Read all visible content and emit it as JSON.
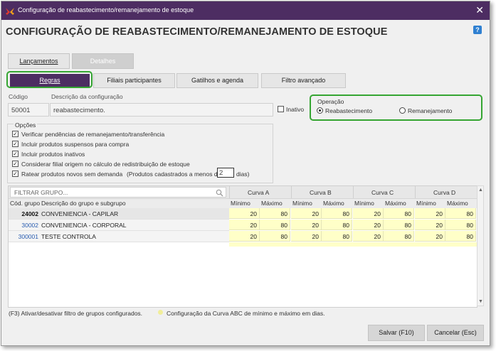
{
  "window": {
    "title": "Configuração de reabastecimento/remanejamento de estoque",
    "close_glyph": "✕",
    "help_glyph": "?"
  },
  "page": {
    "heading": "CONFIGURAÇÃO DE REABASTECIMENTO/REMANEJAMENTO DE ESTOQUE"
  },
  "top_tabs": [
    {
      "label": "Lançamentos",
      "active": false
    },
    {
      "label": "Detalhes",
      "active": true
    }
  ],
  "sub_tabs": [
    {
      "label": "Regras",
      "active": true
    },
    {
      "label": "Filiais participantes",
      "active": false
    },
    {
      "label": "Gatilhos e agenda",
      "active": false
    },
    {
      "label": "Filtro avançado",
      "active": false
    }
  ],
  "form": {
    "codigo_label": "Código",
    "codigo_value": "50001",
    "descricao_label": "Descrição da configuração",
    "descricao_value": "reabastecimento.",
    "inativo_label": "Inativo",
    "inativo_checked": false
  },
  "operacao": {
    "label": "Operação",
    "options": [
      {
        "label": "Reabastecimento",
        "selected": true
      },
      {
        "label": "Remanejamento",
        "selected": false
      }
    ]
  },
  "opcoes": {
    "label": "Opções",
    "items": [
      {
        "label": "Verificar pendências de remanejamento/transferência",
        "checked": true
      },
      {
        "label": "Incluir produtos suspensos para compra",
        "checked": true
      },
      {
        "label": "Incluir produtos inativos",
        "checked": true
      },
      {
        "label": "Considerar filial origem no cálculo de redistribuição de estoque",
        "checked": true
      },
      {
        "label": "Ratear produtos novos sem demanda",
        "checked": true
      }
    ],
    "produtos_prefix": "(Produtos cadastrados a menos de",
    "produtos_days": "2",
    "produtos_suffix": "dias)"
  },
  "grid": {
    "filter_placeholder": "FILTRAR GRUPO...",
    "curvas": [
      "Curva A",
      "Curva B",
      "Curva C",
      "Curva D"
    ],
    "col_codigo": "Cód. grupo",
    "col_descricao": "Descrição do grupo e subgrupo",
    "min_label": "Mínimo",
    "max_label": "Máximo",
    "rows": [
      {
        "codigo": "24002",
        "descricao": "CONVENIENCIA - CAPILAR",
        "vals": [
          "20",
          "80",
          "20",
          "80",
          "20",
          "80",
          "20",
          "80"
        ]
      },
      {
        "codigo": "30002",
        "descricao": "CONVENIENCIA - CORPORAL",
        "vals": [
          "20",
          "80",
          "20",
          "80",
          "20",
          "80",
          "20",
          "80"
        ]
      },
      {
        "codigo": "300001",
        "descricao": "TESTE CONTROLA",
        "vals": [
          "20",
          "80",
          "20",
          "80",
          "20",
          "80",
          "20",
          "80"
        ]
      }
    ]
  },
  "footer": {
    "f3_note": "(F3) Ativar/desativar filtro de grupos configurados.",
    "abc_note": "Configuração da Curva ABC de mínimo e máximo em dias.",
    "highlight_color": "#ffffc8"
  },
  "buttons": {
    "save": "Salvar (F10)",
    "cancel": "Cancelar (Esc)"
  },
  "colors": {
    "titlebar": "#4d2d62",
    "highlight_border": "#35a532",
    "link_blue": "#2a5db0"
  }
}
